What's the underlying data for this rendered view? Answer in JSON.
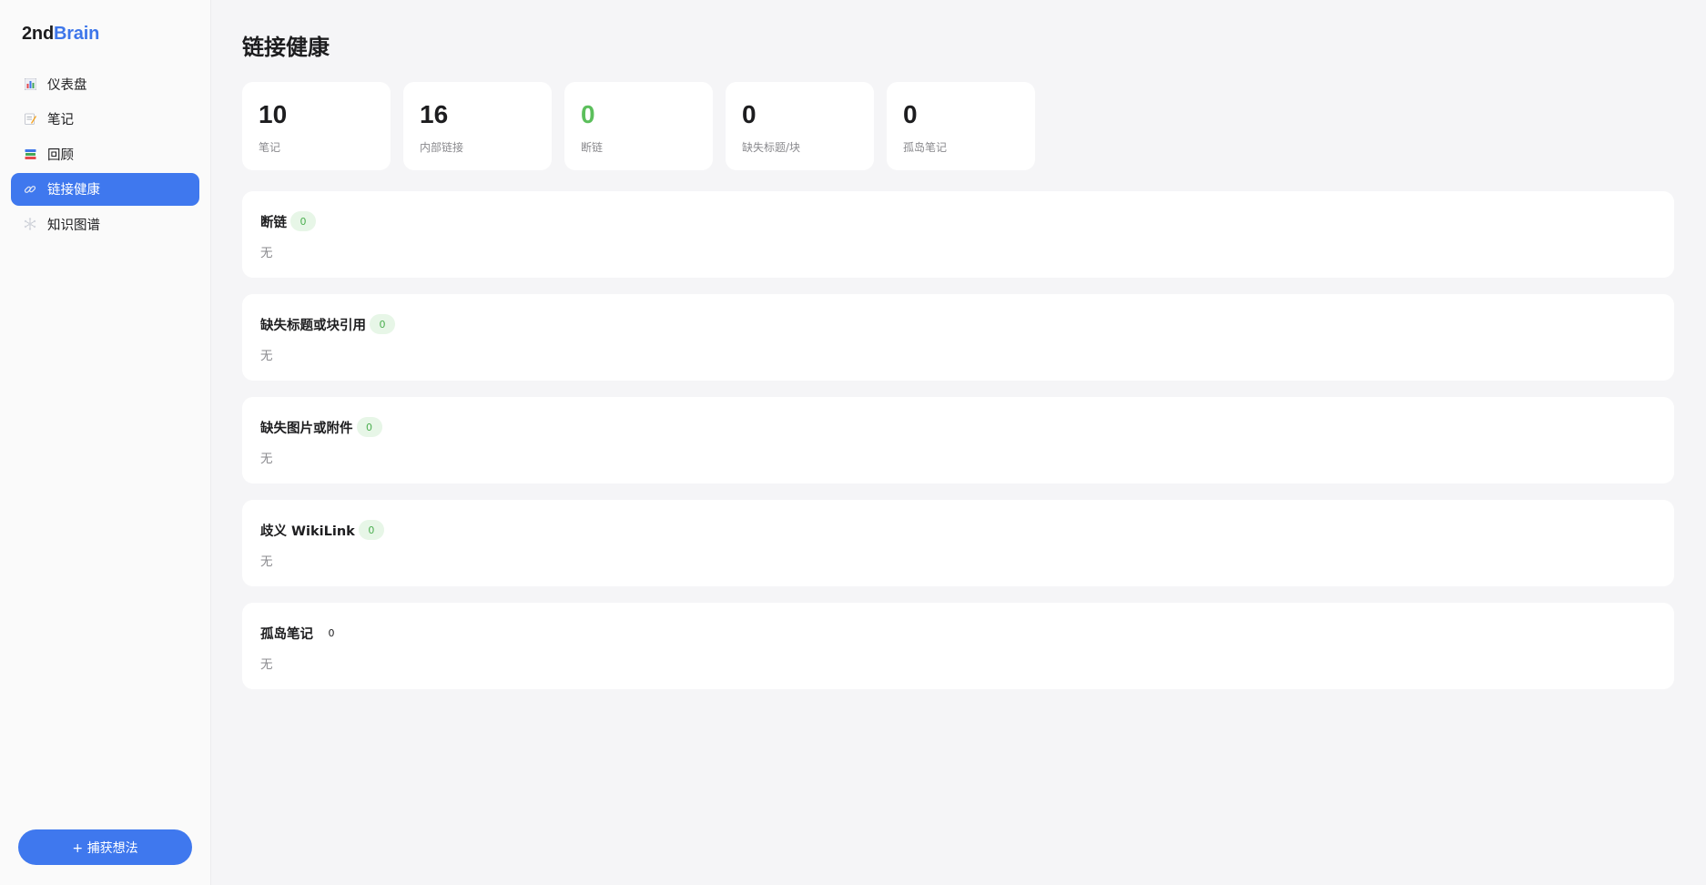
{
  "brand": {
    "part1": "2nd",
    "part2": "Brain"
  },
  "sidebar": {
    "items": [
      {
        "label": "仪表盘",
        "icon": "bar-chart-icon",
        "active": false
      },
      {
        "label": "笔记",
        "icon": "memo-icon",
        "active": false
      },
      {
        "label": "回顾",
        "icon": "books-icon",
        "active": false
      },
      {
        "label": "链接健康",
        "icon": "link-icon",
        "active": true
      },
      {
        "label": "知识图谱",
        "icon": "network-icon",
        "active": false
      }
    ],
    "capture_label": "+ 捕获想法"
  },
  "page": {
    "title": "链接健康"
  },
  "stats": [
    {
      "value": "10",
      "label": "笔记"
    },
    {
      "value": "16",
      "label": "内部链接"
    },
    {
      "value": "0",
      "label": "断链"
    },
    {
      "value": "0",
      "label": "缺失标题/块"
    },
    {
      "value": "0",
      "label": "孤岛笔记"
    }
  ],
  "sections": [
    {
      "title": "断链",
      "count": "0",
      "empty": "无"
    },
    {
      "title": "缺失标题或块引用",
      "count": "0",
      "empty": "无"
    },
    {
      "title": "缺失图片或附件",
      "count": "0",
      "empty": "无"
    },
    {
      "title": "歧义 WikiLink",
      "count": "0",
      "empty": "无"
    },
    {
      "title": "孤岛笔记",
      "count": "0",
      "empty": "无"
    }
  ],
  "colors": {
    "accent": "#3f78ee",
    "ok_green": "#5cbf5c",
    "badge_bg": "#e7f6e7"
  }
}
